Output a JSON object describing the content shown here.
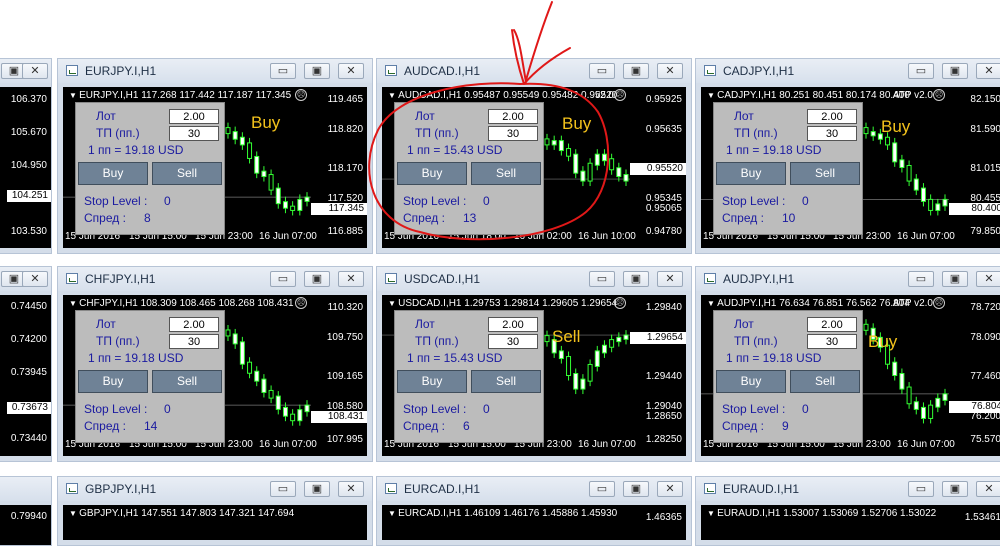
{
  "labels": {
    "lot": "Лот",
    "tp": "ТП (пп.)",
    "stop": "Stop Level :",
    "spread": "Спред :",
    "buy": "Buy",
    "sell": "Sell"
  },
  "window_buttons": {
    "minimize": "▭",
    "restore": "▣",
    "close": "✕"
  },
  "colors": {
    "chart_bg": "#000000",
    "panel_bg": "#bcbcbc",
    "label_blue": "#1a1aa0",
    "signal_yellow": "#f3c21c",
    "candle_green": "#33ff33",
    "annotation_red": "#e01818"
  },
  "left_column": {
    "top": {
      "y_labels": [
        "106.370",
        "105.670",
        "104.950",
        "104.251",
        "103.530"
      ]
    },
    "mid": {
      "y_labels": [
        "0.74450",
        "0.74200",
        "0.73945",
        "0.73673",
        "0.73440"
      ]
    },
    "bot": {
      "y_labels": [
        "0.79940"
      ]
    }
  },
  "windows": [
    {
      "title": "EURJPY.I,H1",
      "chart_header": "EURJPY.I,H1  117.268 117.442 117.187 117.345",
      "version": "",
      "lot": "2.00",
      "tp": "30",
      "pip_text": "1 пп = 19.18 USD",
      "stop_level": "0",
      "spread": "8",
      "signal": "Buy",
      "y_labels": [
        "119.465",
        "118.820",
        "118.170",
        "117.520",
        "117.345",
        "116.885"
      ],
      "x_labels": [
        "15 Jun 2016",
        "15 Jun 15:00",
        "15 Jun 23:00",
        "16 Jun 07:00"
      ]
    },
    {
      "title": "AUDCAD.I,H1",
      "chart_header": "AUDCAD.I,H1  0.95487 0.95549 0.95482 0.95520",
      "version": "v2.0",
      "lot": "2.00",
      "tp": "30",
      "pip_text": "1 пп = 15.43 USD",
      "stop_level": "0",
      "spread": "13",
      "signal": "Buy",
      "y_labels": [
        "0.95925",
        "0.95635",
        "0.95520",
        "0.95345",
        "0.95065",
        "0.94780"
      ],
      "x_labels": [
        "15 Jun 2016",
        "15 Jun 18:00",
        "16 Jun 02:00",
        "16 Jun 10:00"
      ]
    },
    {
      "title": "CADJPY.I,H1",
      "chart_header": "CADJPY.I,H1  80.251 80.451 80.174 80.400",
      "version": "ATP v2.0",
      "lot": "2.00",
      "tp": "30",
      "pip_text": "1 пп = 19.18 USD",
      "stop_level": "0",
      "spread": "10",
      "signal": "Buy",
      "y_labels": [
        "82.150",
        "81.590",
        "81.015",
        "80.455",
        "80.400",
        "79.850"
      ],
      "x_labels": [
        "15 Jun 2016",
        "15 Jun 15:00",
        "15 Jun 23:00",
        "16 Jun 07:00"
      ]
    },
    {
      "title": "CHFJPY.I,H1",
      "chart_header": "CHFJPY.I,H1  108.309 108.465 108.268 108.431",
      "version": "",
      "lot": "2.00",
      "tp": "30",
      "pip_text": "1 пп = 19.18 USD",
      "stop_level": "0",
      "spread": "14",
      "signal": "",
      "y_labels": [
        "110.320",
        "109.750",
        "109.165",
        "108.580",
        "108.431",
        "107.995"
      ],
      "x_labels": [
        "15 Jun 2016",
        "15 Jun 15:00",
        "15 Jun 23:00",
        "16 Jun 07:00"
      ]
    },
    {
      "title": "USDCAD.I,H1",
      "chart_header": "USDCAD.I,H1  1.29753 1.29814 1.29605 1.29654",
      "version": "",
      "lot": "2.00",
      "tp": "30",
      "pip_text": "1 пп = 15.43 USD",
      "stop_level": "0",
      "spread": "6",
      "signal": "Sell",
      "y_labels": [
        "1.29840",
        "1.29654",
        "1.29440",
        "1.29040",
        "1.28650",
        "1.28250"
      ],
      "x_labels": [
        "15 Jun 2016",
        "15 Jun 15:00",
        "15 Jun 23:00",
        "16 Jun 07:00"
      ]
    },
    {
      "title": "AUDJPY.I,H1",
      "chart_header": "AUDJPY.I,H1  76.634 76.851 76.562 76.804",
      "version": "ATP v2.0",
      "lot": "2.00",
      "tp": "30",
      "pip_text": "1 пп = 19.18 USD",
      "stop_level": "0",
      "spread": "9",
      "signal": "Buy",
      "y_labels": [
        "78.720",
        "78.090",
        "77.460",
        "76.804",
        "76.200",
        "75.570"
      ],
      "x_labels": [
        "15 Jun 2016",
        "15 Jun 15:00",
        "15 Jun 23:00",
        "16 Jun 07:00"
      ]
    },
    {
      "title": "GBPJPY.I,H1",
      "chart_header": "GBPJPY.I,H1  147.551 147.803 147.321 147.694",
      "version": "",
      "y_labels": [],
      "x_labels": []
    },
    {
      "title": "EURCAD.I,H1",
      "chart_header": "EURCAD.I,H1  1.46109 1.46176 1.45886 1.45930",
      "version": "",
      "y_labels": [
        "1.46365"
      ],
      "x_labels": []
    },
    {
      "title": "EURAUD.I,H1",
      "chart_header": "EURAUD.I,H1  1.53007 1.53069 1.52706 1.53022",
      "version": "",
      "y_labels": [
        "1.53461"
      ],
      "x_labels": []
    }
  ]
}
